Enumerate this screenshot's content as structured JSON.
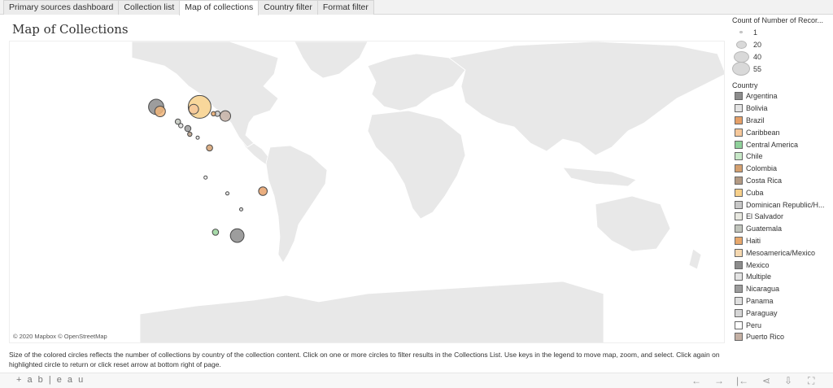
{
  "tabs": [
    "Primary sources dashboard",
    "Collection list",
    "Map of collections",
    "Country filter",
    "Format filter"
  ],
  "active_tab": 2,
  "title": "Map of Collections",
  "map": {
    "attribution": "© 2020 Mapbox © OpenStreetMap",
    "points": [
      {
        "name": "Mexico",
        "count": 25,
        "color": "#8c8c8c",
        "lon": -101,
        "lat": 22
      },
      {
        "name": "Mesoamerica/Mexico",
        "count": 12,
        "color": "#f0b57a",
        "lon": -99,
        "lat": 20
      },
      {
        "name": "Cuba",
        "count": 55,
        "color": "#f7d08a",
        "lon": -79,
        "lat": 22
      },
      {
        "name": "Caribbean",
        "count": 10,
        "color": "#f6c89a",
        "lon": -82,
        "lat": 21
      },
      {
        "name": "Dominican Republic/Haiti",
        "count": 3,
        "color": "#c8c8c8",
        "lon": -70,
        "lat": 19
      },
      {
        "name": "Haiti",
        "count": 2,
        "color": "#e8a86c",
        "lon": -72,
        "lat": 19
      },
      {
        "name": "Puerto Rico",
        "count": 12,
        "color": "#c4b0a4",
        "lon": -66,
        "lat": 18
      },
      {
        "name": "Guatemala",
        "count": 3,
        "color": "#c0c4bc",
        "lon": -90,
        "lat": 15.5
      },
      {
        "name": "El Salvador",
        "count": 2,
        "color": "#dedede",
        "lon": -88.5,
        "lat": 13.8
      },
      {
        "name": "Nicaragua",
        "count": 4,
        "color": "#9c9c9c",
        "lon": -85,
        "lat": 12.5
      },
      {
        "name": "Costa Rica",
        "count": 2,
        "color": "#b39a84",
        "lon": -84,
        "lat": 10
      },
      {
        "name": "Panama",
        "count": 1,
        "color": "#e0e0e0",
        "lon": -80,
        "lat": 8.5
      },
      {
        "name": "Colombia",
        "count": 4,
        "color": "#d4a070",
        "lon": -74,
        "lat": 4
      },
      {
        "name": "Peru",
        "count": 1,
        "color": "#ffffff",
        "lon": -76,
        "lat": -9
      },
      {
        "name": "Bolivia",
        "count": 1,
        "color": "#e4e4e4",
        "lon": -65,
        "lat": -16
      },
      {
        "name": "Brazil",
        "count": 8,
        "color": "#e6a068",
        "lon": -47,
        "lat": -15
      },
      {
        "name": "Paraguay",
        "count": 1,
        "color": "#d6d6d6",
        "lon": -58,
        "lat": -23
      },
      {
        "name": "Chile",
        "count": 4,
        "color": "#98d49a",
        "lon": -71,
        "lat": -33
      },
      {
        "name": "Argentina",
        "count": 20,
        "color": "#8c8c8c",
        "lon": -60,
        "lat": -34.5
      }
    ]
  },
  "legend": {
    "size_title": "Count of Number of Recor...",
    "sizes": [
      {
        "label": "1",
        "d": 4
      },
      {
        "label": "20",
        "d": 13
      },
      {
        "label": "40",
        "d": 19
      },
      {
        "label": "55",
        "d": 23
      }
    ],
    "color_title": "Country",
    "countries": [
      {
        "label": "Argentina",
        "color": "#8c8c8c"
      },
      {
        "label": "Bolivia",
        "color": "#e4e4e4"
      },
      {
        "label": "Brazil",
        "color": "#e6a068"
      },
      {
        "label": "Caribbean",
        "color": "#f6c89a"
      },
      {
        "label": "Central America",
        "color": "#8fd19a"
      },
      {
        "label": "Chile",
        "color": "#c8e8c8"
      },
      {
        "label": "Colombia",
        "color": "#d4a070"
      },
      {
        "label": "Costa Rica",
        "color": "#b39a84"
      },
      {
        "label": "Cuba",
        "color": "#f7d08a"
      },
      {
        "label": "Dominican Republic/H...",
        "color": "#c8c8c8"
      },
      {
        "label": "El Salvador",
        "color": "#e8e8e0"
      },
      {
        "label": "Guatemala",
        "color": "#c0c4bc"
      },
      {
        "label": "Haiti",
        "color": "#e8a86c"
      },
      {
        "label": "Mesoamerica/Mexico",
        "color": "#f5d8b0"
      },
      {
        "label": "Mexico",
        "color": "#8c8c8c"
      },
      {
        "label": "Multiple",
        "color": "#e4e4e4"
      },
      {
        "label": "Nicaragua",
        "color": "#9c9c9c"
      },
      {
        "label": "Panama",
        "color": "#e0e0e0"
      },
      {
        "label": "Paraguay",
        "color": "#d6d6d6"
      },
      {
        "label": "Peru",
        "color": "#ffffff"
      },
      {
        "label": "Puerto Rico",
        "color": "#c4b0a4"
      }
    ]
  },
  "caption": "Size of the colored circles reflects the number of collections by country of the collection content. Click on one or more circles to filter results in the Collections List. Use keys in the legend to move map, zoom, and select. Click again on highlighted circle to return or click reset arrow at bottom right of page.",
  "footer": {
    "logo": "+ a b | e a u",
    "controls": [
      {
        "icon": "undo-icon",
        "glyph": "←"
      },
      {
        "icon": "redo-icon",
        "glyph": "→"
      },
      {
        "icon": "reset-icon",
        "glyph": "|←"
      },
      {
        "icon": "share-icon",
        "glyph": "⋖"
      },
      {
        "icon": "download-icon",
        "glyph": "⇩"
      },
      {
        "icon": "fullscreen-icon",
        "glyph": "⛶"
      }
    ]
  }
}
